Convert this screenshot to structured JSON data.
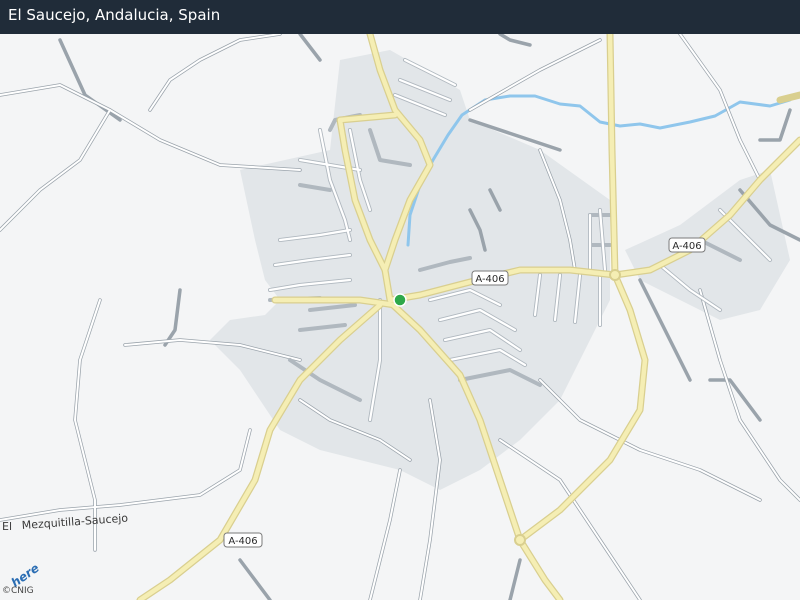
{
  "header": {
    "title": "El Saucejo, Andalucia, Spain"
  },
  "road_labels": [
    "A-406",
    "A-406",
    "A-406"
  ],
  "place_labels": {
    "west": "El",
    "road": "Mezquitilla-Saucejo"
  },
  "marker": {
    "color": "#2ea84a"
  },
  "attribution": {
    "logo": "here",
    "copyright": "©CNIG"
  },
  "colors": {
    "background": "#f4f5f6",
    "urban": "#e2e6e9",
    "major_road": "#f5eeb4",
    "river": "#8fc6ec",
    "header": "#202c39"
  }
}
